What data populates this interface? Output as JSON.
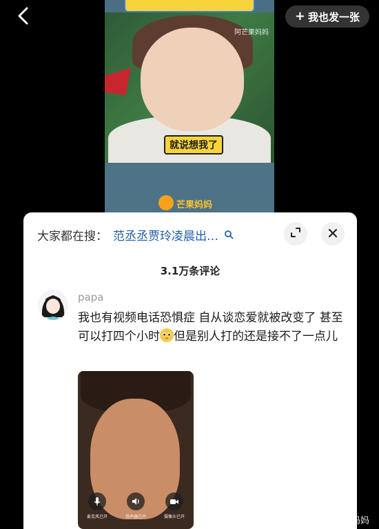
{
  "topbar": {
    "back_icon": "chevron-left-icon",
    "post_button_plus": "+",
    "post_button_label": "我也发一张"
  },
  "video": {
    "watermark": "阿芒果妈妈",
    "caption": "就说想我了",
    "logo_text": "芒果妈妈"
  },
  "search": {
    "label": "大家都在搜：",
    "query": "范丞丞贾玲凌晨出…"
  },
  "comments": {
    "count_label": "3.1万条评论",
    "items": [
      {
        "username": "papa",
        "text_part1": "我也有视频电话恐惧症 自从谈恋爱就被改变了 甚至可以打四个小时",
        "text_part2": "但是别人打的还是接不了一点儿",
        "call_controls": [
          {
            "icon": "microphone-icon",
            "label": "麦克风已开"
          },
          {
            "icon": "speaker-icon",
            "label": "扬声器已开"
          },
          {
            "icon": "camera-icon",
            "label": "摄像头已开"
          }
        ]
      }
    ]
  },
  "watermark": {
    "at": "@",
    "text": "芒果妈妈"
  }
}
